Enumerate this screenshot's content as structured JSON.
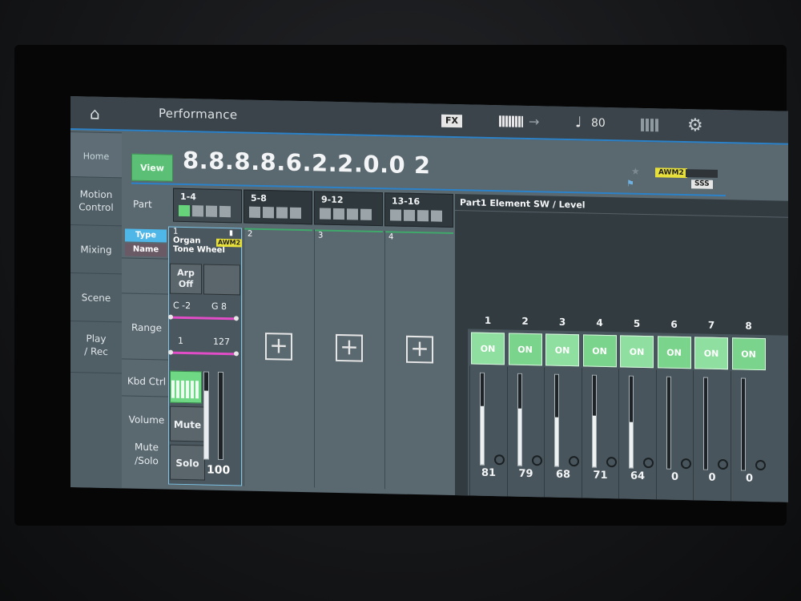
{
  "topbar": {
    "title": "Performance",
    "fx": "FX",
    "tempo": "80",
    "icons": [
      "home-icon",
      "piano-icon",
      "usb-icon",
      "note-icon",
      "grid-icon",
      "gear-icon"
    ]
  },
  "menu": {
    "items": [
      "Home",
      "Motion\nControl",
      "Mixing",
      "Scene",
      "Play\n/ Rec"
    ]
  },
  "performance": {
    "view": "View",
    "name": "8.8.8.8.6.2.2.0.0 2",
    "awm": "AWM2",
    "sss": "SSS"
  },
  "part": {
    "label": "Part",
    "tabs": [
      {
        "label": "1-4",
        "cells": [
          true,
          false,
          false,
          false
        ]
      },
      {
        "label": "5-8",
        "cells": [
          false,
          false,
          false,
          false
        ]
      },
      {
        "label": "9-12",
        "cells": [
          false,
          false,
          false,
          false
        ]
      },
      {
        "label": "13-16",
        "cells": [
          false,
          false,
          false,
          false
        ]
      }
    ]
  },
  "labels": {
    "type": "Type",
    "name": "Name",
    "range": "Range",
    "kbd_ctrl": "Kbd Ctrl",
    "volume": "Volume",
    "mute_solo": "Mute\n/Solo"
  },
  "part1": {
    "number": "1",
    "name": "Organ\nTone Wheel",
    "awm": "AWM2",
    "arp": "Arp\nOff",
    "note_low": "C -2",
    "note_high": "G 8",
    "vel_low": "1",
    "vel_high": "127",
    "mute": "Mute",
    "solo": "Solo",
    "volume": "100",
    "volume_level": 0.79
  },
  "empty_parts": [
    "2",
    "3",
    "4"
  ],
  "element": {
    "title": "Part1 Element SW / Level",
    "on_label": "ON",
    "elements": [
      {
        "num": "1",
        "level": 81
      },
      {
        "num": "2",
        "level": 79
      },
      {
        "num": "3",
        "level": 68
      },
      {
        "num": "4",
        "level": 71
      },
      {
        "num": "5",
        "level": 64
      },
      {
        "num": "6",
        "level": 0
      },
      {
        "num": "7",
        "level": 0
      },
      {
        "num": "8",
        "level": 0
      }
    ]
  }
}
